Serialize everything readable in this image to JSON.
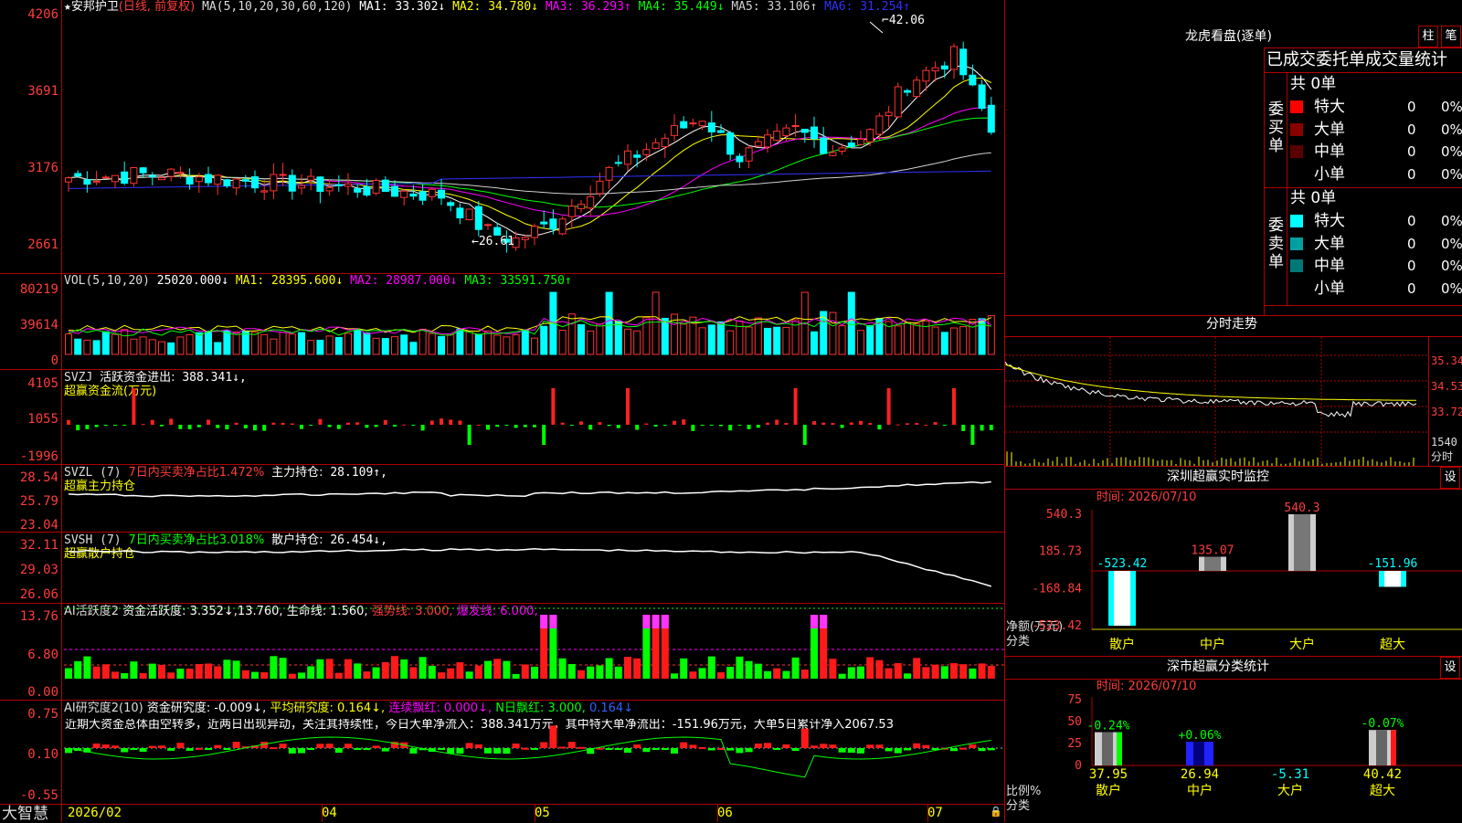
{
  "main_chart": {
    "stock_name": "安邦护卫",
    "period_label": "(日线, 前复权)",
    "ma_spec": "MA(5,10,20,30,60,120)",
    "ma": [
      {
        "name": "MA1:",
        "value": "33.302↓",
        "color": "#ffffff"
      },
      {
        "name": "MA2:",
        "value": "34.780↓",
        "color": "#ffff00"
      },
      {
        "name": "MA3:",
        "value": "36.293↑",
        "color": "#ff00ff"
      },
      {
        "name": "MA4:",
        "value": "35.449↓",
        "color": "#00ff00"
      },
      {
        "name": "MA5:",
        "value": "33.106↑",
        "color": "#d0d0d0"
      },
      {
        "name": "MA6:",
        "value": "31.254↑",
        "color": "#3030ff"
      }
    ],
    "high_label": "42.06",
    "low_label": "26.61",
    "y_ticks": [
      "4206",
      "3691",
      "3176",
      "2661"
    ]
  },
  "volume": {
    "title": "VOL(5,10,20)",
    "value": "25020.000↓",
    "ma": [
      {
        "name": "MA1:",
        "value": "28395.600↓",
        "color": "#ffff00"
      },
      {
        "name": "MA2:",
        "value": "28987.000↓",
        "color": "#ff00ff"
      },
      {
        "name": "MA3:",
        "value": "33591.750↑",
        "color": "#00ff00"
      }
    ],
    "y_ticks": [
      "80219",
      "39614",
      "0"
    ]
  },
  "svzj": {
    "title": "SVZJ",
    "label": "活跃资金进出:",
    "value": "388.341↓,",
    "subtitle": "超赢资金流(万元)",
    "y_ticks": [
      "4105",
      "1055",
      "-1996"
    ]
  },
  "svzl": {
    "title": "SVZL (7)",
    "ratio": "7日内买卖净占比1.472%",
    "holding_label": "主力持仓:",
    "holding_value": "28.109↑,",
    "subtitle": "超赢主力持仓",
    "y_ticks": [
      "28.54",
      "25.79",
      "23.04"
    ]
  },
  "svsh": {
    "title": "SVSH (7)",
    "ratio": "7日内买卖净占比3.018%",
    "holding_label": "散户持仓:",
    "holding_value": "26.454↓,",
    "subtitle": "超赢散户持仓",
    "y_ticks": [
      "32.11",
      "29.03",
      "26.06"
    ]
  },
  "ai_active": {
    "title": "AI活跃度2",
    "label": "资金活跃度:",
    "value1": "3.352↓,",
    "value2": "13.760,",
    "life_line": "生命线: 1.560,",
    "strong_line": "强势线: 3.000,",
    "burst_line": "爆发线: 6.000,",
    "y_ticks": [
      "13.76",
      "6.80",
      "0.00"
    ]
  },
  "ai_research": {
    "title": "AI研究度2(10)",
    "label": "资金研究度:",
    "value": "-0.009↓,",
    "avg": "平均研究度: 0.164↓,",
    "consecutive": "连续飘红: 0.000↓,",
    "n_days": "N日飘红: 3.000,",
    "last": "0.164↓",
    "commentary": "近期大资金总体由空转多，近两日出现异动，关注其持续性，今日大单净流入：388.341万元，其中特大单净流出：-151.96万元，大单5日累计净入2067.53",
    "y_ticks": [
      "0.75",
      "0.10",
      "-0.55"
    ]
  },
  "x_axis": {
    "ticks": [
      "2026/02",
      "04",
      "05",
      "06",
      "07"
    ],
    "brand": "大智慧"
  },
  "dragon_tiger": {
    "title": "龙虎看盘(逐单)",
    "btn_bar": "柱",
    "btn_stroke": "笔",
    "header_tabs": [
      "已成交",
      "委托单",
      "成交量统计"
    ],
    "buy_side_label": "委买单",
    "sell_side_label": "委卖单",
    "buy_total": "共 0单",
    "sell_total": "共 0单",
    "buy_rows": [
      {
        "label": "特大",
        "count": "0",
        "pct": "0%",
        "color": "#ff0000"
      },
      {
        "label": "大单",
        "count": "0",
        "pct": "0%",
        "color": "#8a0000"
      },
      {
        "label": "中单",
        "count": "0",
        "pct": "0%",
        "color": "#5a0000"
      },
      {
        "label": "小单",
        "count": "0",
        "pct": "0%",
        "color": ""
      }
    ],
    "sell_rows": [
      {
        "label": "特大",
        "count": "0",
        "pct": "0%",
        "color": "#00ffff"
      },
      {
        "label": "大单",
        "count": "0",
        "pct": "0%",
        "color": "#00a0a0"
      },
      {
        "label": "中单",
        "count": "0",
        "pct": "0%",
        "color": "#007878"
      },
      {
        "label": "小单",
        "count": "0",
        "pct": "0%",
        "color": ""
      }
    ]
  },
  "intraday": {
    "title": "分时走势",
    "price_ticks": [
      "35.34",
      "34.53",
      "33.72"
    ],
    "volume_tick": "1540",
    "unit_label": "分时"
  },
  "sz_monitor": {
    "title": "深圳超赢实时监控",
    "btn": "设",
    "time_label": "时间: 2026/07/10",
    "y_ticks": [
      "540.3",
      "185.73",
      "-168.84",
      "-523.42"
    ],
    "net_label": "净额(万元)",
    "cat_label": "分类",
    "categories": [
      "散户",
      "中户",
      "大户",
      "超大"
    ],
    "values": [
      -523.42,
      135.07,
      540.3,
      -151.96
    ],
    "value_labels": [
      "-523.42",
      "135.07",
      "540.3",
      "-151.96"
    ]
  },
  "sz_stats": {
    "title": "深市超赢分类统计",
    "btn": "设",
    "time_label": "时间: 2026/07/10",
    "y_ticks": [
      "75",
      "50",
      "25",
      "0"
    ],
    "ratio_label": "比例%",
    "cat_label": "分类",
    "categories": [
      "散户",
      "中户",
      "大户",
      "超大"
    ],
    "pct_values": [
      37.95,
      26.94,
      -5.31,
      40.42
    ],
    "pct_labels": [
      "37.95",
      "26.94",
      "-5.31",
      "40.42"
    ],
    "change_labels": [
      "-0.24%",
      "+0.06%",
      "",
      "-0.07%"
    ]
  }
}
